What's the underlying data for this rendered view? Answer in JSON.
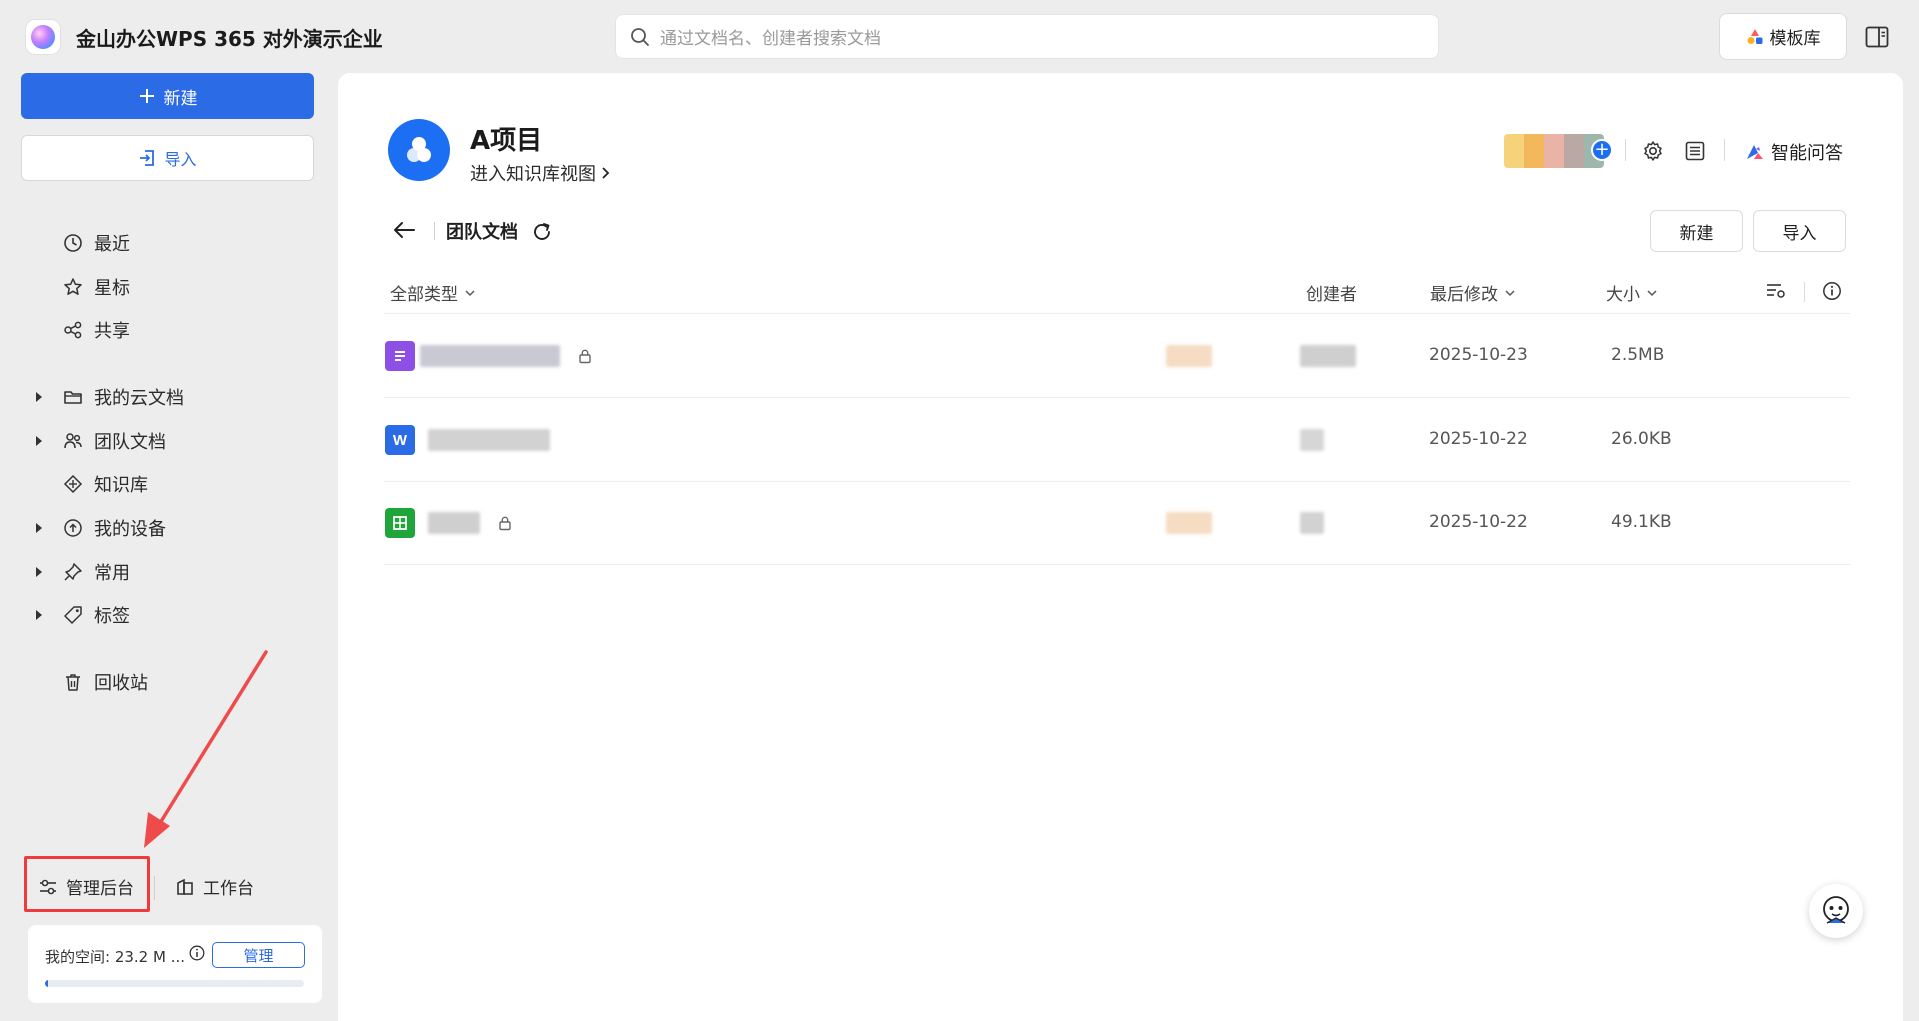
{
  "app": {
    "title": "金山办公WPS 365 对外演示企业"
  },
  "search": {
    "placeholder": "通过文档名、创建者搜索文档"
  },
  "header": {
    "template_label": "模板库"
  },
  "sidebar": {
    "new_label": "新建",
    "import_label": "导入",
    "items": [
      {
        "label": "最近",
        "icon": "clock-icon",
        "expandable": false
      },
      {
        "label": "星标",
        "icon": "star-icon",
        "expandable": false
      },
      {
        "label": "共享",
        "icon": "share-icon",
        "expandable": false
      },
      {
        "label": "我的云文档",
        "icon": "folder-icon",
        "expandable": true
      },
      {
        "label": "团队文档",
        "icon": "team-icon",
        "expandable": true
      },
      {
        "label": "知识库",
        "icon": "knowledge-icon",
        "expandable": false
      },
      {
        "label": "我的设备",
        "icon": "cloud-upload-icon",
        "expandable": true
      },
      {
        "label": "常用",
        "icon": "pin-icon",
        "expandable": true
      },
      {
        "label": "标签",
        "icon": "tag-icon",
        "expandable": true
      },
      {
        "label": "回收站",
        "icon": "trash-icon",
        "expandable": false
      }
    ],
    "admin_label": "管理后台",
    "workbench_label": "工作台",
    "storage": {
      "text": "我的空间: 23.2 M ...",
      "manage_label": "管理",
      "used_fraction": 0.01
    }
  },
  "project": {
    "title": "A项目",
    "link_label": "进入知识库视图",
    "ai_label": "智能问答"
  },
  "toolbar": {
    "crumb": "团队文档",
    "new_label": "新建",
    "import_label": "导入"
  },
  "table": {
    "columns": {
      "type": "全部类型",
      "creator": "创建者",
      "modified": "最后修改",
      "size": "大小"
    },
    "rows": [
      {
        "type": "document",
        "modified": "2025-10-23",
        "size": "2.5MB",
        "locked": true
      },
      {
        "type": "word",
        "modified": "2025-10-22",
        "size": "26.0KB",
        "locked": false
      },
      {
        "type": "spreadsheet",
        "modified": "2025-10-22",
        "size": "49.1KB",
        "locked": true
      }
    ]
  },
  "colors": {
    "accent": "#2b6be6",
    "highlight": "#ef3b3b"
  }
}
